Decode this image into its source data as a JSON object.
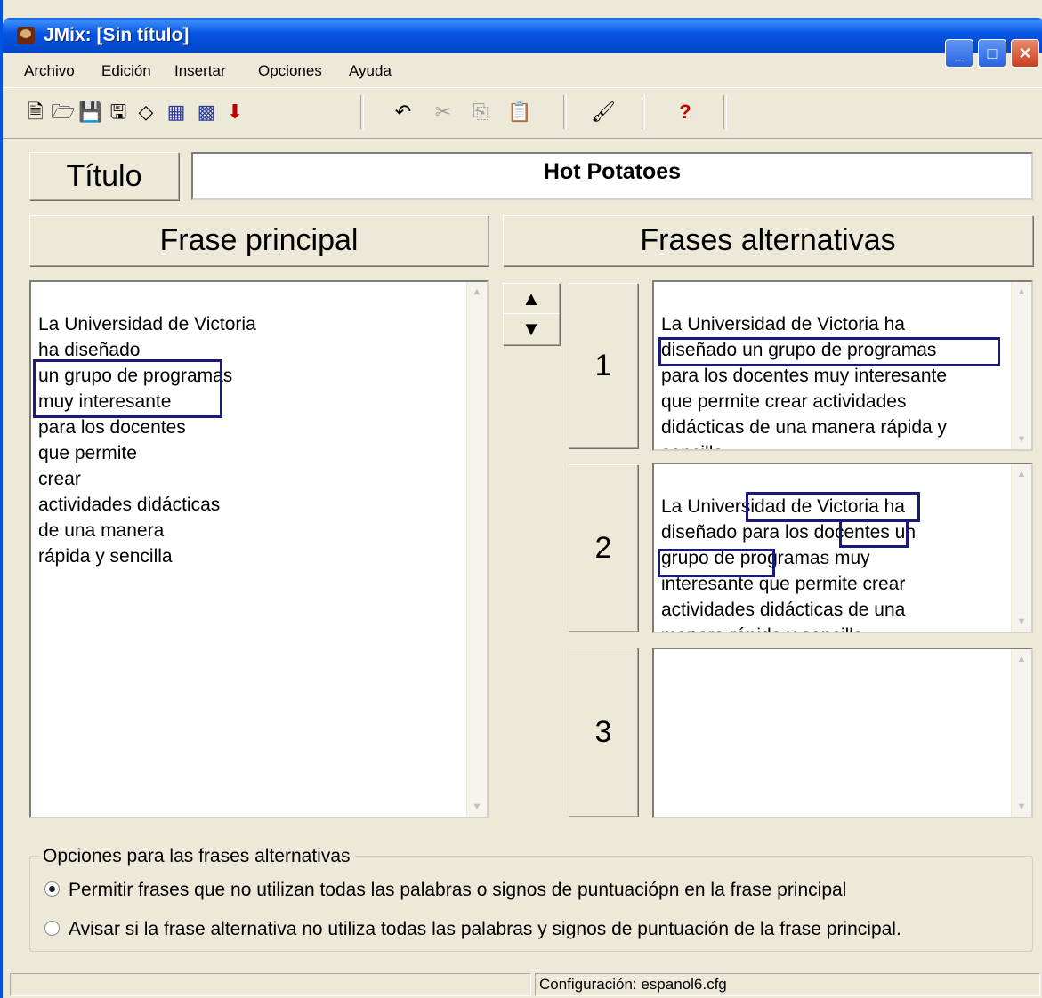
{
  "window": {
    "title": "JMix: [Sin título]"
  },
  "menu": [
    "Archivo",
    "Edición",
    "Insertar",
    "Opciones",
    "Ayuda"
  ],
  "toolbar": {
    "icons": [
      "new-file-icon",
      "open-folder-icon",
      "save-icon",
      "save-as-icon",
      "eraser-icon",
      "web-page-icon",
      "web-page-alt-icon",
      "export-arrow-icon",
      "undo-icon",
      "cut-icon",
      "copy-icon",
      "paste-icon",
      "configure-icon",
      "help-icon"
    ]
  },
  "titulo": {
    "label": "Título",
    "value": "Hot Potatoes"
  },
  "headers": {
    "main": "Frase principal",
    "alternatives": "Frases alternativas"
  },
  "main_sentence": [
    "La Universidad de Victoria",
    "ha diseñado",
    "un grupo de programas",
    "muy interesante",
    "para los docentes",
    "que permite",
    "crear",
    "actividades didácticas",
    "de una manera",
    "rápida y sencilla"
  ],
  "alternatives": [
    {
      "number": "1",
      "lines": [
        "La Universidad de Victoria ha",
        "diseñado un grupo de programas",
        "para los docentes muy interesante",
        "que permite crear actividades",
        "didácticas de una manera rápida y",
        "sencilla"
      ]
    },
    {
      "number": "2",
      "lines": [
        "La Universidad de Victoria ha",
        "diseñado para los docentes un",
        "grupo de programas muy",
        "interesante que permite crear",
        "actividades didácticas de una",
        "manera rápida y sencilla"
      ]
    },
    {
      "number": "3",
      "lines": []
    }
  ],
  "options": {
    "legend": "Opciones para las frases alternativas",
    "radio1": "Permitir frases que no utilizan todas las palabras o signos de puntuaciópn en la frase principal",
    "radio2": "Avisar si la frase alternativa no utiliza todas las palabras y signos de puntuación de la frase principal.",
    "selected": 1
  },
  "status": {
    "config": "Configuración: espanol6.cfg"
  },
  "colors": {
    "titlebar": "#0553e2",
    "highlight_box": "#1a1a7a",
    "background": "#ece9d8"
  }
}
